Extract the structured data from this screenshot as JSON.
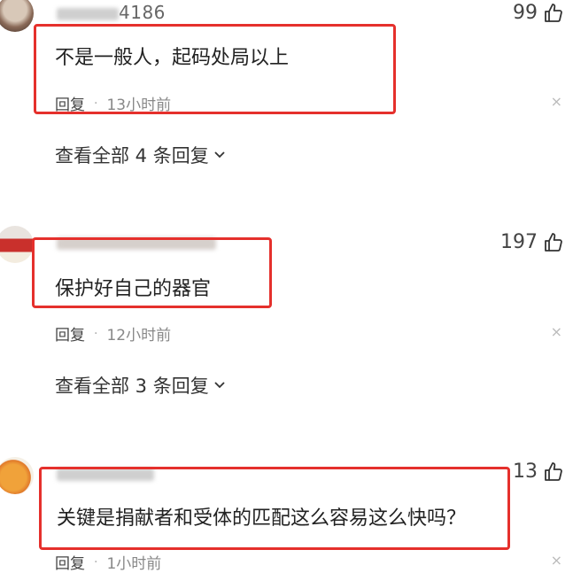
{
  "comments": [
    {
      "username_visible": "4186",
      "likes": "99",
      "content": "不是一般人，起码处局以上",
      "reply_label": "回复",
      "separator": "·",
      "time": "13小时前",
      "close_glyph": "×",
      "view_replies": "查看全部 4 条回复"
    },
    {
      "username_visible": "",
      "likes": "197",
      "content": "保护好自己的器官",
      "reply_label": "回复",
      "separator": "·",
      "time": "12小时前",
      "close_glyph": "×",
      "view_replies": "查看全部 3 条回复"
    },
    {
      "username_visible": "",
      "likes": "13",
      "content": "关键是捐献者和受体的匹配这么容易这么快吗？",
      "reply_label": "回复",
      "separator": "·",
      "time": "1小时前",
      "close_glyph": "×"
    }
  ],
  "colors": {
    "highlight_border": "#e5302c",
    "meta_text": "#888888",
    "body_text": "#222222"
  },
  "icons": {
    "like": "thumbs-up-icon",
    "expand": "chevron-down-icon",
    "dismiss": "close-icon"
  }
}
